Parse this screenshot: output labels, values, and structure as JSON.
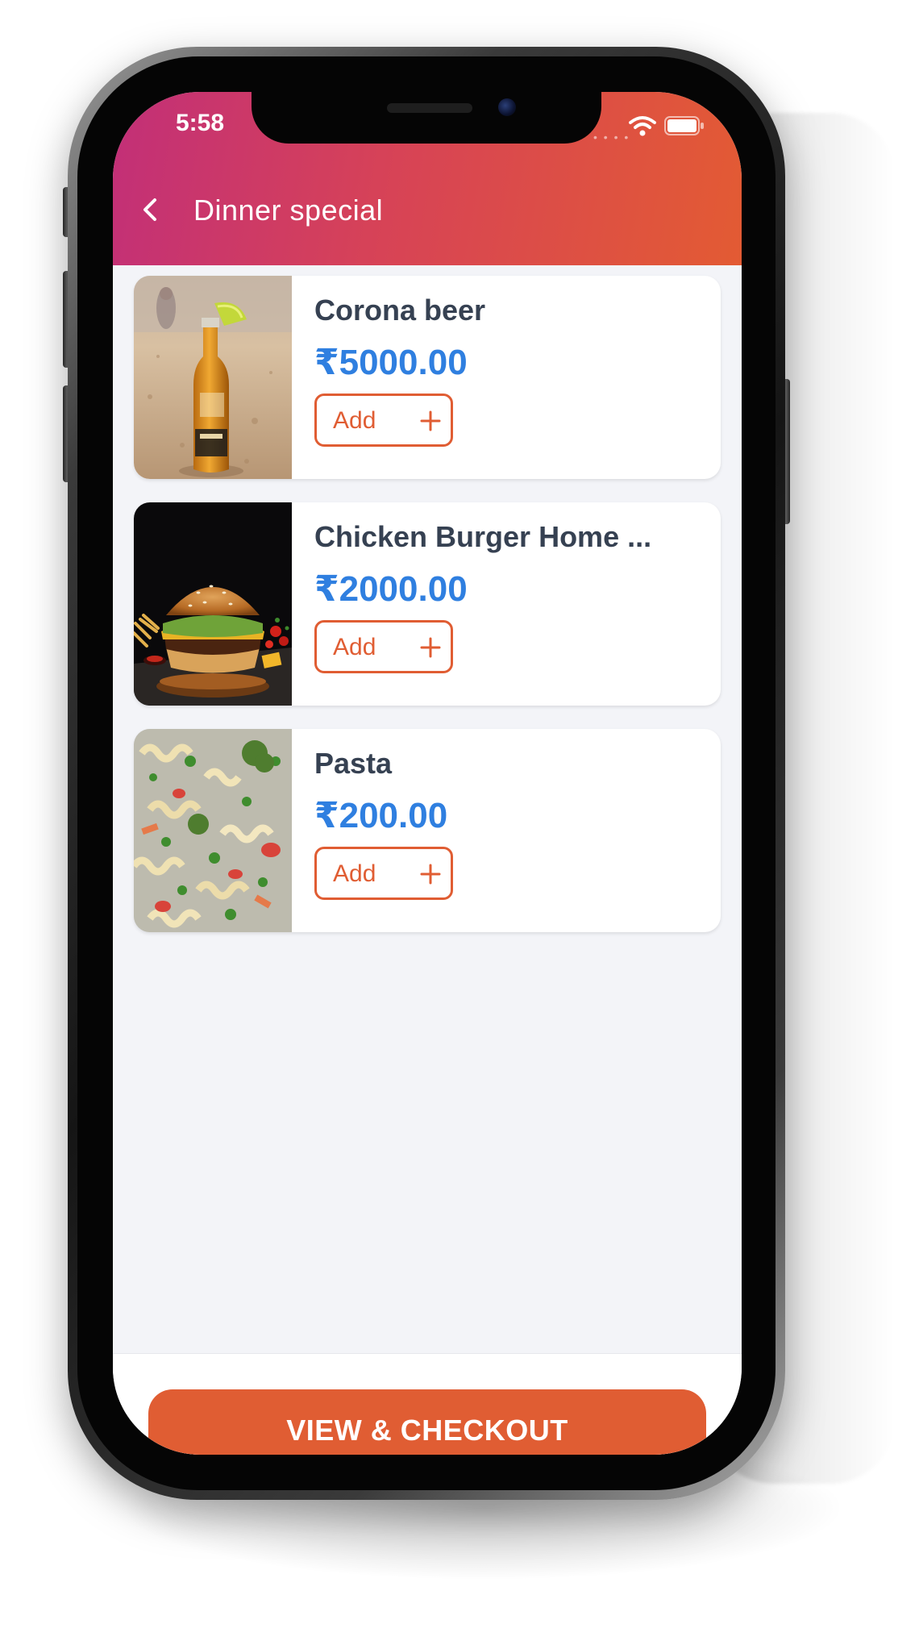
{
  "status_bar": {
    "time": "5:58",
    "wifi_icon": "wifi-icon",
    "battery_icon": "battery-icon"
  },
  "header": {
    "back_icon": "chevron-left-icon",
    "title": "Dinner special",
    "gradient_colors": [
      "#c22f78",
      "#e35b33"
    ]
  },
  "menu_items": [
    {
      "name": "Corona beer",
      "price": "₹5000.00",
      "add_label": "Add",
      "add_icon": "plus-icon",
      "image": "beer-bottle-on-sand-photo"
    },
    {
      "name": "Chicken Burger Home ...",
      "price": "₹2000.00",
      "add_label": "Add",
      "add_icon": "plus-icon",
      "image": "chicken-burger-photo"
    },
    {
      "name": "Pasta",
      "price": "₹200.00",
      "add_label": "Add",
      "add_icon": "plus-icon",
      "image": "pasta-salad-photo"
    }
  ],
  "footer": {
    "checkout_label": "VIEW & CHECKOUT"
  },
  "colors": {
    "accent": "#e05d33",
    "price": "#2f7fe0",
    "item_name": "#364152",
    "background": "#f3f4f8"
  }
}
